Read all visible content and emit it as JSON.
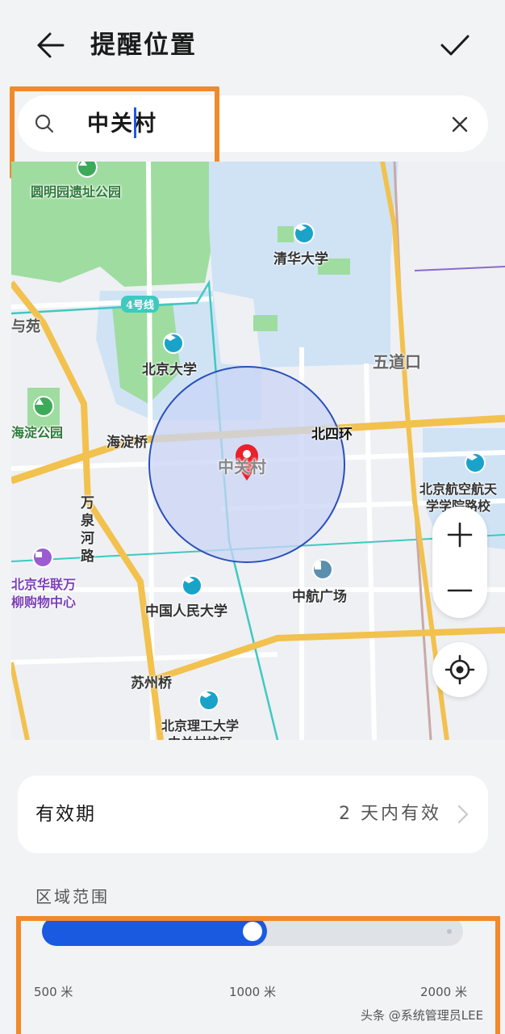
{
  "header": {
    "title": "提醒位置",
    "back_icon": "arrow-left-icon",
    "confirm_icon": "checkmark-icon"
  },
  "search": {
    "value": "中关村",
    "icon": "search-icon",
    "clear_icon": "close-icon"
  },
  "map": {
    "labels": {
      "yuanmingyuan": "圆明园遗址公园",
      "tsinghua": "清华大学",
      "line4": "4号线",
      "yuan": "与苑",
      "pku": "北京大学",
      "wudaokou": "五道口",
      "haidian_park": "海淀公园",
      "haidian_bridge": "海淀桥",
      "north_4th_ring": "北四环",
      "zhongguancun": "中关村",
      "beihang_1": "北京航空航天",
      "beihang_2": "学学院路校",
      "wanquanhe": "万泉河路",
      "hualian_1": "北京华联万",
      "hualian_2": "柳购物中心",
      "renmin": "中国人民大学",
      "zhonghang": "中航广场",
      "suzhou_bridge": "苏州桥",
      "bit_1": "北京理工大学",
      "bit_2": "中关村校区"
    },
    "zoom_in_icon": "plus-icon",
    "zoom_out_icon": "minus-icon",
    "locate_icon": "locate-icon",
    "colors": {
      "radius_fill": "#c9d4f5",
      "radius_stroke": "#2a4fb8",
      "pin": "#e8212b",
      "ring_road": "#f2c14e",
      "park": "#9fdca0",
      "campus": "#cfe3f5"
    }
  },
  "validity": {
    "label": "有效期",
    "value": "2 天内有效",
    "chevron_icon": "chevron-right-icon"
  },
  "range": {
    "title": "区域范围",
    "value_fraction": 0.5,
    "ticks": [
      "500 米",
      "1000 米",
      "2000 米"
    ],
    "accent_color": "#1a5ae0"
  },
  "watermark": "头条 @系统管理员LEE",
  "highlight_color": "#f08a2a"
}
